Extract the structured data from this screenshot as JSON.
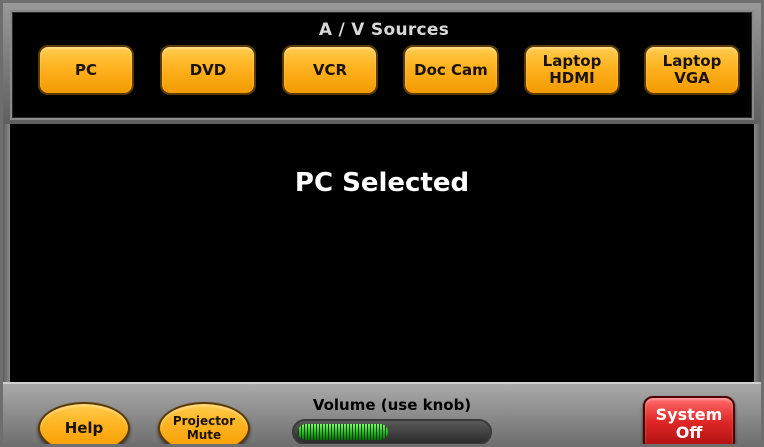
{
  "sources": {
    "title": "A / V Sources",
    "buttons": [
      {
        "label": "PC"
      },
      {
        "label": "DVD"
      },
      {
        "label": "VCR"
      },
      {
        "label": "Doc Cam"
      },
      {
        "label": "Laptop\nHDMI"
      },
      {
        "label": "Laptop\nVGA"
      }
    ]
  },
  "main": {
    "status": "PC Selected"
  },
  "controls": {
    "help_label": "Help",
    "mute_label": "Projector\nMute",
    "volume_label": "Volume (use knob)",
    "volume_level": 0.48,
    "power_label": "System\nOff"
  },
  "colors": {
    "source_button": "#ffb21f",
    "power_button": "#e02727",
    "volume_fill": "#1fb81f"
  }
}
